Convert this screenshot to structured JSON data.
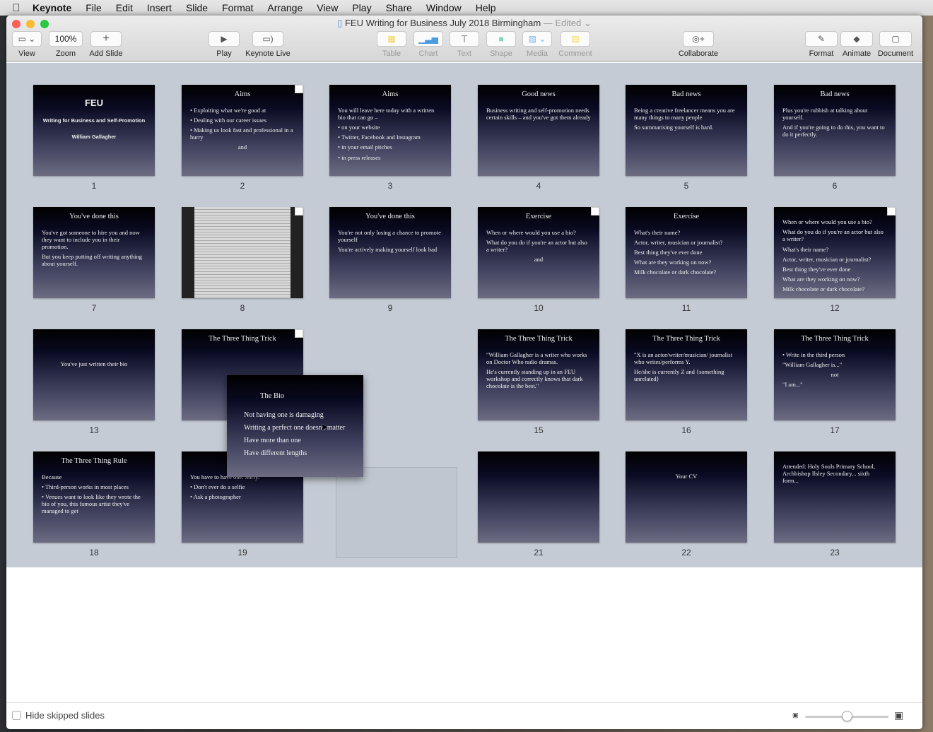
{
  "menubar": {
    "app": "Keynote",
    "items": [
      "File",
      "Edit",
      "Insert",
      "Slide",
      "Format",
      "Arrange",
      "View",
      "Play",
      "Share",
      "Window",
      "Help"
    ]
  },
  "window": {
    "title": "FEU Writing for Business July 2018 Birmingham",
    "status": "— Edited"
  },
  "toolbar": {
    "view": "View",
    "zoom_value": "100%",
    "zoom": "Zoom",
    "add_slide": "Add Slide",
    "play": "Play",
    "keynote_live": "Keynote Live",
    "table": "Table",
    "chart": "Chart",
    "text": "Text",
    "shape": "Shape",
    "media": "Media",
    "comment": "Comment",
    "collaborate": "Collaborate",
    "format": "Format",
    "animate": "Animate",
    "document": "Document"
  },
  "slides": [
    {
      "num": "1",
      "title": "",
      "lines": [
        "Writing for Business and Self-Promotion",
        "William Gallagher"
      ],
      "logo": "FEU"
    },
    {
      "num": "2",
      "title": "Aims",
      "lines": [
        "• Exploiting what we're good at",
        "• Dealing with our career issues",
        "• Making us look fast and professional in a hurry",
        "and"
      ],
      "notes": true
    },
    {
      "num": "3",
      "title": "Aims",
      "lines": [
        "You will leave here today with a written bio that can go –",
        "• on your website",
        "• Twitter, Facebook and Instagram",
        "• in your email pitches",
        "• in press releases"
      ]
    },
    {
      "num": "4",
      "title": "Good news",
      "lines": [
        "Business writing and self-promotion needs certain skills – and you've got them already"
      ]
    },
    {
      "num": "5",
      "title": "Bad news",
      "lines": [
        "Being a creative freelancer means you are many things to many people",
        "So summarising yourself is hard."
      ]
    },
    {
      "num": "6",
      "title": "Bad news",
      "lines": [
        "Plus you're rubbish at talking about yourself.",
        "And if you're going to do this, you want to do it perfectly."
      ]
    },
    {
      "num": "7",
      "title": "You've done this",
      "lines": [
        "You've got someone to hire you and now they want to include you in their promotion.",
        "But you keep putting off writing anything about yourself."
      ]
    },
    {
      "num": "8",
      "title": "",
      "lines": [],
      "notes": true,
      "image": true
    },
    {
      "num": "9",
      "title": "You've done this",
      "lines": [
        "You're not only losing a chance to promote yourself",
        "You're actively making yourself look bad"
      ]
    },
    {
      "num": "10",
      "title": "Exercise",
      "lines": [
        "When or where would you use a bio?",
        "What do you do if you're an actor but also a writer?",
        "and"
      ],
      "notes": true
    },
    {
      "num": "11",
      "title": "Exercise",
      "lines": [
        "What's their name?",
        "Actor, writer, musician or journalist?",
        "Best thing they've ever done",
        "What are they working on now?",
        "Milk chocolate or dark chocolate?"
      ]
    },
    {
      "num": "12",
      "title": "",
      "lines": [
        "When or where would you use a bio?",
        "What do you do if you're an actor but also a writer?",
        "What's their name?",
        "Actor, writer, musician or journalist?",
        "Best thing they've ever done",
        "What are they working on now?",
        "Milk chocolate or dark chocolate?"
      ],
      "notes": true
    },
    {
      "num": "13",
      "title": "",
      "lines": [
        "You've just written their bio"
      ]
    },
    {
      "num": "14",
      "title": "The Three Thing Trick",
      "lines": [],
      "notes": true
    },
    {
      "num": "15",
      "title": "The Three Thing Trick",
      "lines": [
        "\"William Gallagher is a writer who works on Doctor Who radio dramas.",
        "He's currently standing up in an FEU workshop and correctly knows that dark chocolate is the best.\""
      ]
    },
    {
      "num": "16",
      "title": "The Three Thing Trick",
      "lines": [
        "\"X is an actor/writer/musician/ journalist who writes/performs Y.",
        "He/she is currently Z and {something unrelated}"
      ]
    },
    {
      "num": "17",
      "title": "The Three Thing Trick",
      "lines": [
        "• Write in the third person",
        "\"William Gallagher is...\"",
        "not",
        "\"I am...\""
      ]
    },
    {
      "num": "18",
      "title": "The Three Thing Rule",
      "lines": [
        "Because",
        "• Third-person works in most places",
        "• Venues want to look like they wrote the bio of you, this famous artist they've managed to get"
      ]
    },
    {
      "num": "19",
      "title": "The D",
      "lines": [
        "You have to have one. Sorry.",
        "• Don't ever do a selfie",
        "• Ask a photographer"
      ]
    },
    {
      "num": "21",
      "title": "",
      "lines": []
    },
    {
      "num": "22",
      "title": "",
      "lines": [
        "Your CV"
      ]
    },
    {
      "num": "23",
      "title": "",
      "lines": [
        "Attended: Holy Souls Primary School, Archbishop Ilsley Secondary... sixth form..."
      ]
    }
  ],
  "dragged_slide": {
    "title": "The Bio",
    "lines": [
      "Not having one is damaging",
      "Writing a perfect one doesn't matter",
      "Have more than one",
      "Have different lengths"
    ]
  },
  "footer": {
    "hide_skipped": "Hide skipped slides",
    "slider_value": 0.5
  }
}
